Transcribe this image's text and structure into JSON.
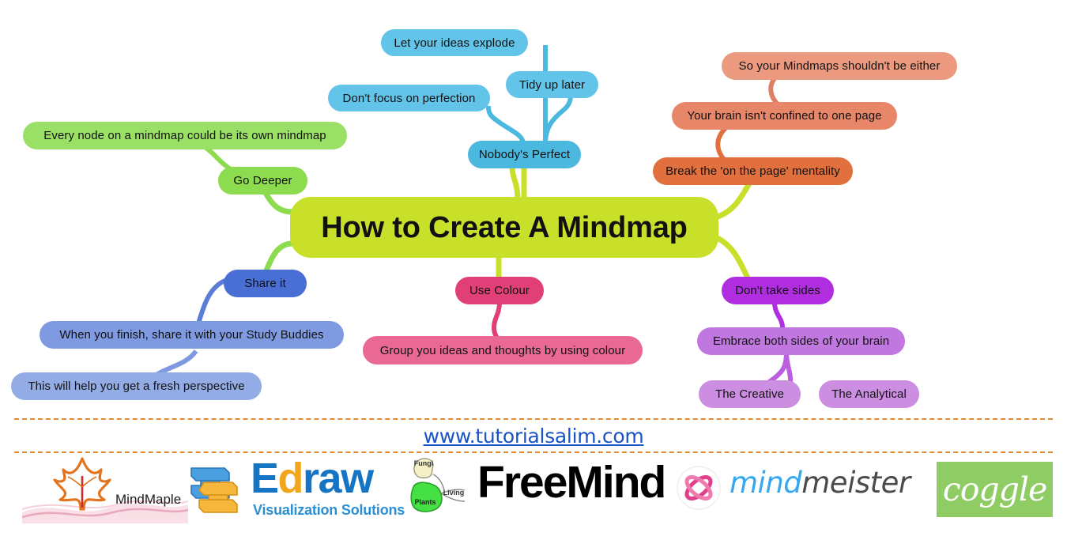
{
  "mindmap": {
    "central": {
      "label": "How to Create A Mindmap",
      "color": "#c8e02a"
    },
    "branches": [
      {
        "name": "nobodys-perfect",
        "color": "#4bb8e0",
        "nodes": [
          {
            "label": "Nobody's Perfect",
            "color": "#4bb8e0"
          },
          {
            "label": "Tidy up later",
            "color": "#61c4e8"
          },
          {
            "label": "Let your ideas explode",
            "color": "#61c4e8"
          },
          {
            "label": "Don't focus on perfection",
            "color": "#61c4e8"
          }
        ]
      },
      {
        "name": "break-the-page-mentality",
        "color": "#e2703f",
        "nodes": [
          {
            "label": "Break the 'on the page' mentality",
            "color": "#e2703f"
          },
          {
            "label": "Your brain isn't confined to one page",
            "color": "#e8866a"
          },
          {
            "label": "So your Mindmaps shouldn't be either",
            "color": "#eb9a80"
          }
        ]
      },
      {
        "name": "go-deeper",
        "color": "#8ddb4e",
        "nodes": [
          {
            "label": "Go Deeper",
            "color": "#8ddb4e"
          },
          {
            "label": "Every node on a mindmap could be its own mindmap",
            "color": "#9be066"
          }
        ]
      },
      {
        "name": "share-it",
        "color": "#4a6fd4",
        "nodes": [
          {
            "label": "Share it",
            "color": "#4a6fd4"
          },
          {
            "label": "When you finish, share it with your Study Buddies",
            "color": "#7f9ae0"
          },
          {
            "label": "This will help you get a fresh perspective",
            "color": "#93ace6"
          }
        ]
      },
      {
        "name": "use-colour",
        "color": "#e04077",
        "nodes": [
          {
            "label": "Use Colour",
            "color": "#e04077"
          },
          {
            "label": "Group you ideas and thoughts by using colour",
            "color": "#ea6894"
          }
        ]
      },
      {
        "name": "dont-take-sides",
        "color": "#b02ee0",
        "nodes": [
          {
            "label": "Don't take sides",
            "color": "#b02ee0"
          },
          {
            "label": "Embrace both sides of your brain",
            "color": "#c munched"
          },
          {
            "label": "The Creative",
            "color": "#cb8ee0"
          },
          {
            "label": "The Analytical",
            "color": "#cb8ee0"
          }
        ]
      }
    ]
  },
  "footer": {
    "url": "www.tutorialsalim.com",
    "divider_color": "#e08a33"
  },
  "logos": {
    "mindmaple": {
      "name": "MindMaple",
      "text": "MindMaple",
      "leaf_color": "#e2741f"
    },
    "edraw": {
      "name": "Edraw",
      "text_part1": "E",
      "text_part2": "d",
      "text_part3": "raw",
      "tagline": "Visualization Solutions"
    },
    "freemind": {
      "name": "FreeMind",
      "text": "FreeMind",
      "icon_label_top": "Fungi",
      "icon_label_mid": "Living",
      "icon_label_bottom": "Plants"
    },
    "mindmeister": {
      "name": "mindmeister",
      "text_part1": "mind",
      "text_part2": "meister"
    },
    "coggle": {
      "name": "coggle",
      "text": "coggle",
      "bg_color": "#8fcc64"
    }
  }
}
